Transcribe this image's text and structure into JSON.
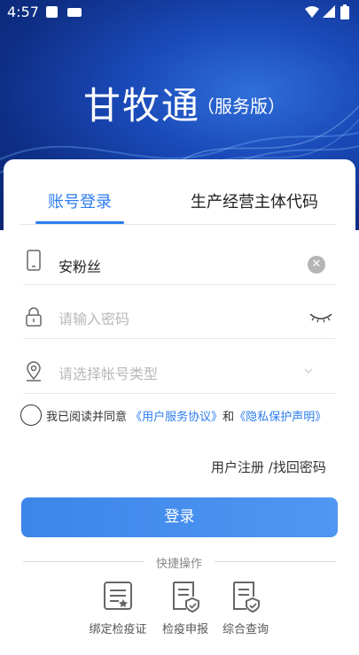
{
  "status_bar": {
    "time": "4:57"
  },
  "header": {
    "title": "甘牧通",
    "subtitle": "（服务版）"
  },
  "tabs": [
    {
      "label": "账号登录",
      "active": true
    },
    {
      "label": "生产经营主体代码",
      "active": false
    }
  ],
  "form": {
    "account_value": "安粉丝",
    "password_placeholder": "请输入密码",
    "account_type_placeholder": "请选择帐号类型"
  },
  "agreement": {
    "prefix": "我已阅读并同意",
    "link1": "《用户服务协议》",
    "and": "和",
    "link2": "《隐私保护声明》"
  },
  "links": {
    "register": "用户注册",
    "separator": " /",
    "recover": "找回密码"
  },
  "login_button": "登录",
  "quick": {
    "title": "快捷操作",
    "items": [
      {
        "label": "绑定检疫证",
        "icon": "certificate-icon"
      },
      {
        "label": "检疫申报",
        "icon": "declaration-icon"
      },
      {
        "label": "综合查询",
        "icon": "query-icon"
      }
    ]
  },
  "colors": {
    "accent": "#2b7cf0",
    "button": "#4a90ee",
    "hero": "#1a49b8"
  }
}
